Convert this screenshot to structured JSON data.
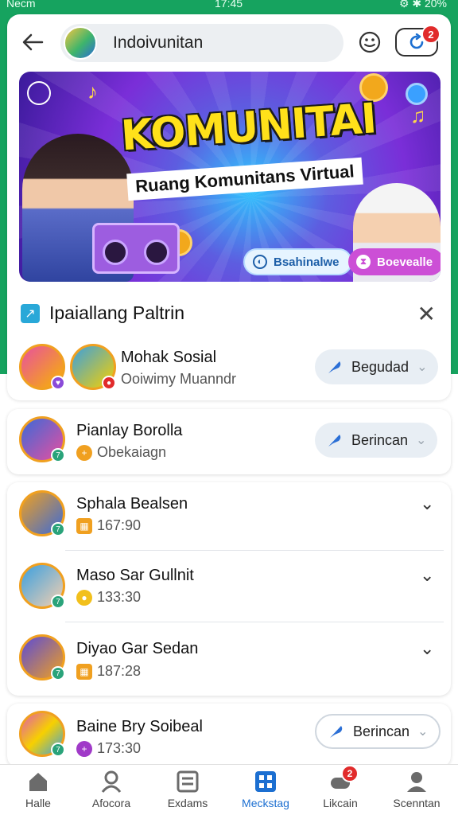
{
  "status_bar": {
    "left": "Necm",
    "time": "17:45",
    "right": "⚙ ✱ 20%"
  },
  "header": {
    "search_title": "Indoivunitan",
    "notification_count": "2"
  },
  "banner": {
    "title": "KOMUNITAI",
    "subtitle": "Ruang Komunitans Virtual",
    "chip_left": "Bsahinalwe",
    "chip_right": "Boevealle"
  },
  "section": {
    "title": "Ipaiallang Paltrin"
  },
  "rows": [
    {
      "name": "Mohak Sosial",
      "meta": "Ooiwimy Muanndr",
      "button": "Begudad",
      "avatar_color": "#e84fa0"
    },
    {
      "name": "Pianlay Borolla",
      "meta": "Obekaiagn",
      "button": "Berincan",
      "avatar_color": "#3b6ad8"
    },
    {
      "name": "Sphala Bealsen",
      "meta": "167:90",
      "avatar_color": "#f0a020"
    },
    {
      "name": "Maso Sar Gullnit",
      "meta": "133:30",
      "avatar_color": "#3aa0e0"
    },
    {
      "name": "Diyao Gar Sedan",
      "meta": "187:28",
      "avatar_color": "#5a4ad8"
    },
    {
      "name": "Baine Bry Soibeal",
      "meta": "173:30",
      "button": "Berincan",
      "avatar_color": "#e05ab0"
    }
  ],
  "bottom_nav": [
    {
      "label": "Halle",
      "icon": "home-icon"
    },
    {
      "label": "Afocora",
      "icon": "person-icon"
    },
    {
      "label": "Exdams",
      "icon": "list-icon"
    },
    {
      "label": "Meckstag",
      "icon": "grid-icon",
      "active": true
    },
    {
      "label": "Likcain",
      "icon": "game-icon",
      "badge": "2"
    },
    {
      "label": "Scenntan",
      "icon": "profile-icon"
    }
  ],
  "colors": {
    "brand_green": "#16a35f",
    "accent_blue": "#1c6fd1",
    "badge_red": "#e12b2b"
  }
}
